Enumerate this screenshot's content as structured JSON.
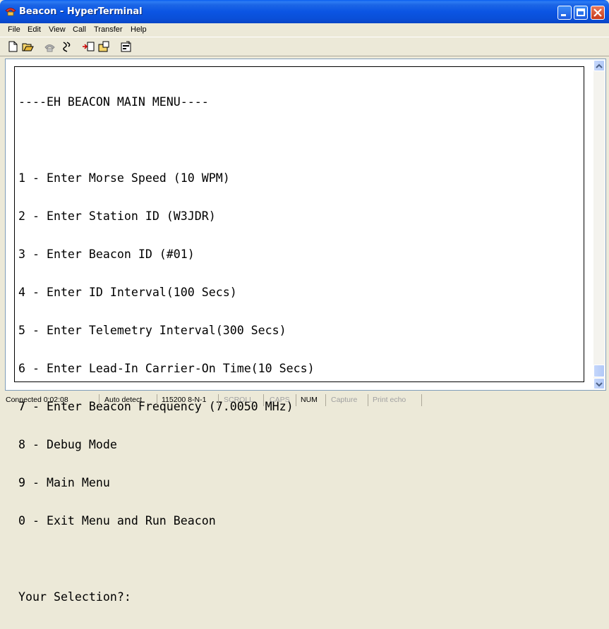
{
  "window": {
    "title": "Beacon - HyperTerminal"
  },
  "menu": [
    "File",
    "Edit",
    "View",
    "Call",
    "Transfer",
    "Help"
  ],
  "toolbar": [
    "new-icon",
    "open-icon",
    "connect-icon",
    "disconnect-icon",
    "send-icon",
    "receive-icon",
    "properties-icon"
  ],
  "terminal": {
    "lines": [
      "----EH BEACON MAIN MENU----",
      "",
      "1 - Enter Morse Speed (10 WPM)",
      "2 - Enter Station ID (W3JDR)",
      "3 - Enter Beacon ID (#01)",
      "4 - Enter ID Interval(100 Secs)",
      "5 - Enter Telemetry Interval(300 Secs)",
      "6 - Enter Lead-In Carrier-On Time(10 Secs)",
      "7 - Enter Beacon Frequency (7.0050 MHz)",
      "8 - Debug Mode",
      "9 - Main Menu",
      "0 - Exit Menu and Run Beacon",
      "",
      "Your Selection?:"
    ]
  },
  "status": {
    "connection": "Connected 0:02:08",
    "detect": "Auto detect",
    "settings": "115200 8-N-1",
    "scroll": "SCROLL",
    "caps": "CAPS",
    "num": "NUM",
    "capture": "Capture",
    "print_echo": "Print echo"
  }
}
